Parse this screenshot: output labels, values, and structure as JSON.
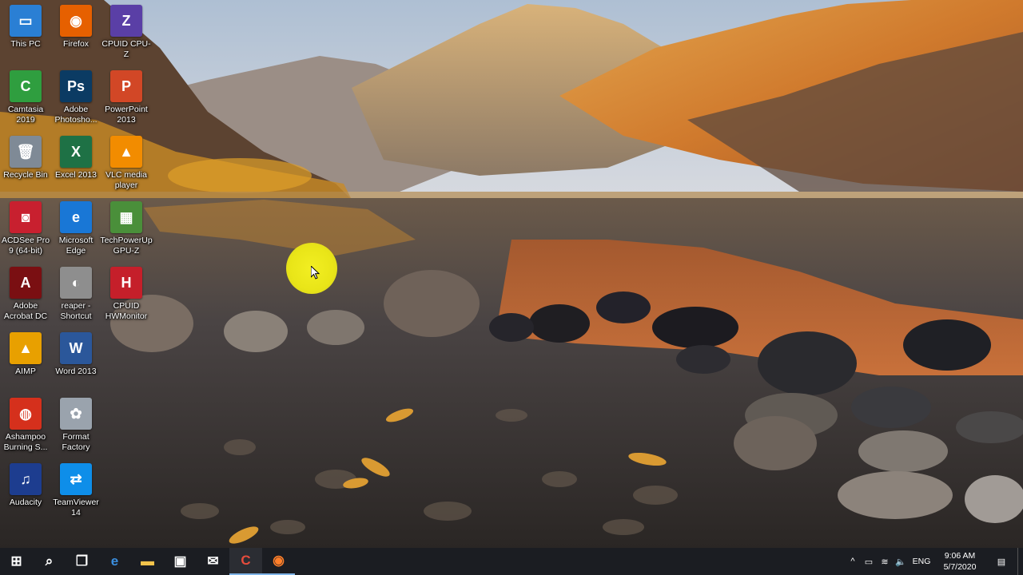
{
  "desktop": {
    "icons": [
      {
        "label": "This PC",
        "glyph": "▭",
        "bg": "#2a7fd4",
        "col": 0,
        "row": 0
      },
      {
        "label": "Firefox",
        "glyph": "◉",
        "bg": "#e66000",
        "col": 1,
        "row": 0
      },
      {
        "label": "CPUID CPU-Z",
        "glyph": "Z",
        "bg": "#5a3fa6",
        "col": 2,
        "row": 0
      },
      {
        "label": "Camtasia 2019",
        "glyph": "C",
        "bg": "#2f9e3f",
        "col": 0,
        "row": 1
      },
      {
        "label": "Adobe Photosho...",
        "glyph": "Ps",
        "bg": "#0b3b63",
        "col": 1,
        "row": 1
      },
      {
        "label": "PowerPoint 2013",
        "glyph": "P",
        "bg": "#d24726",
        "col": 2,
        "row": 1
      },
      {
        "label": "Recycle Bin",
        "glyph": "🗑",
        "bg": "#7f8a96",
        "col": 0,
        "row": 2
      },
      {
        "label": "Excel 2013",
        "glyph": "X",
        "bg": "#1e7145",
        "col": 1,
        "row": 2
      },
      {
        "label": "VLC media player",
        "glyph": "▲",
        "bg": "#f28c00",
        "col": 2,
        "row": 2
      },
      {
        "label": "ACDSee Pro 9 (64-bit)",
        "glyph": "◙",
        "bg": "#c8202f",
        "col": 0,
        "row": 3
      },
      {
        "label": "Microsoft Edge",
        "glyph": "e",
        "bg": "#1977d6",
        "col": 1,
        "row": 3
      },
      {
        "label": "TechPowerUp GPU-Z",
        "glyph": "▦",
        "bg": "#4a8f3a",
        "col": 2,
        "row": 3
      },
      {
        "label": "Adobe Acrobat DC",
        "glyph": "A",
        "bg": "#7a0f12",
        "col": 0,
        "row": 4
      },
      {
        "label": "reaper - Shortcut",
        "glyph": "◐",
        "bg": "#8e8e8e",
        "col": 1,
        "row": 4
      },
      {
        "label": "CPUID HWMonitor",
        "glyph": "H",
        "bg": "#c51f2a",
        "col": 2,
        "row": 4
      },
      {
        "label": "AIMP",
        "glyph": "▲",
        "bg": "#e8a000",
        "col": 0,
        "row": 5
      },
      {
        "label": "Word 2013",
        "glyph": "W",
        "bg": "#2b579a",
        "col": 1,
        "row": 5
      },
      {
        "label": "Ashampoo Burning S...",
        "glyph": "◍",
        "bg": "#d5301c",
        "col": 0,
        "row": 6
      },
      {
        "label": "Format Factory",
        "glyph": "✿",
        "bg": "#9aa3ad",
        "col": 1,
        "row": 6
      },
      {
        "label": "Audacity",
        "glyph": "♫",
        "bg": "#1d3d8f",
        "col": 0,
        "row": 7
      },
      {
        "label": "TeamViewer 14",
        "glyph": "⇄",
        "bg": "#0e8ee9",
        "col": 1,
        "row": 7
      }
    ]
  },
  "taskbar": {
    "buttons": [
      {
        "name": "start-button",
        "glyph": "⊞",
        "color": "#ffffff"
      },
      {
        "name": "search-button",
        "glyph": "⌕",
        "color": "#ffffff"
      },
      {
        "name": "task-view-button",
        "glyph": "❐",
        "color": "#ffffff"
      },
      {
        "name": "edge-taskbar-button",
        "glyph": "e",
        "color": "#3b8fe0"
      },
      {
        "name": "file-explorer-taskbar-button",
        "glyph": "▬",
        "color": "#f3c34b"
      },
      {
        "name": "store-taskbar-button",
        "glyph": "▣",
        "color": "#ffffff"
      },
      {
        "name": "mail-taskbar-button",
        "glyph": "✉",
        "color": "#ffffff"
      },
      {
        "name": "camtasia-taskbar-button",
        "glyph": "C",
        "color": "#e74c3c"
      },
      {
        "name": "firefox-taskbar-button",
        "glyph": "◉",
        "color": "#ff7f2a"
      }
    ],
    "tray": {
      "chevron": "^",
      "battery": "▭",
      "network": "≋",
      "volume": "🔈",
      "language": "ENG",
      "time": "9:06 AM",
      "date": "5/7/2020",
      "notification": "▤"
    }
  }
}
